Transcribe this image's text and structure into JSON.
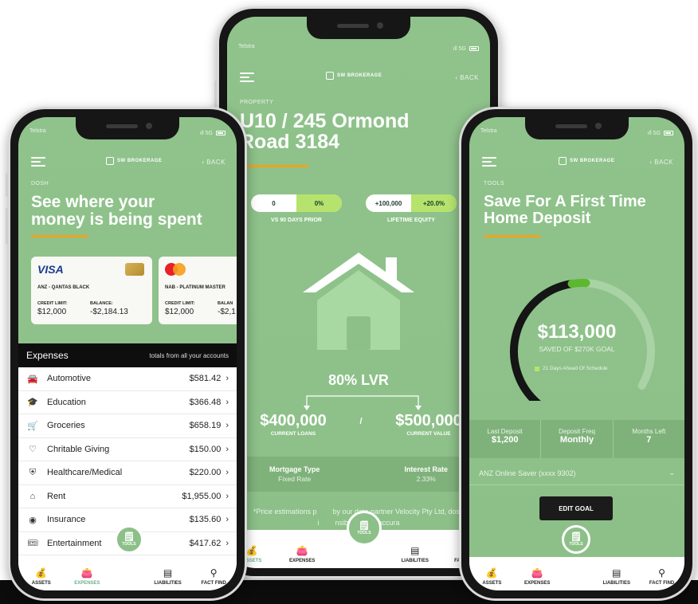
{
  "colors": {
    "brand_green": "#8cc088",
    "accent_orange": "#f2a21b",
    "lime": "#b6e36d",
    "dark": "#0e0e0e"
  },
  "phone_left": {
    "status": {
      "carrier": "Telstra",
      "signal": "ıll 5G"
    },
    "brand": "SW BROKERAGE",
    "back": "‹ BACK",
    "section": "DOSH",
    "title_line1": "See where your",
    "title_line2": "money is being spent",
    "cards": [
      {
        "brand": "VISA",
        "name": "ANZ - QANTAS BLACK",
        "limit_label": "CREDIT LIMIT:",
        "limit": "$12,000",
        "balance_label": "BALANCE:",
        "balance": "-$2,184.13"
      },
      {
        "name": "NAB - PLATINUM MASTER",
        "limit_label": "CREDIT LIMIT:",
        "limit": "$12,000",
        "balance_label": "BALAN",
        "balance": "-$2,1"
      }
    ],
    "expenses_header": {
      "title": "Expenses",
      "subtitle": "totals from all your accounts"
    },
    "expenses": [
      {
        "icon": "car-icon",
        "glyph": "🚘",
        "name": "Automotive",
        "amount": "$581.42"
      },
      {
        "icon": "education-icon",
        "glyph": "🎓",
        "name": "Education",
        "amount": "$366.48"
      },
      {
        "icon": "groceries-icon",
        "glyph": "🛒",
        "name": "Groceries",
        "amount": "$658.19"
      },
      {
        "icon": "giving-icon",
        "glyph": "♡",
        "name": "Chritable Giving",
        "amount": "$150.00"
      },
      {
        "icon": "healthcare-icon",
        "glyph": "⛨",
        "name": "Healthcare/Medical",
        "amount": "$220.00"
      },
      {
        "icon": "rent-icon",
        "glyph": "⌂",
        "name": "Rent",
        "amount": "$1,955.00"
      },
      {
        "icon": "insurance-icon",
        "glyph": "◉",
        "name": "Insurance",
        "amount": "$135.60"
      },
      {
        "icon": "entertainment-icon",
        "glyph": "🎟",
        "name": "Entertainment",
        "amount": "$417.62"
      }
    ],
    "tabs": [
      {
        "icon": "assets-icon",
        "glyph": "💰",
        "label": "ASSETS"
      },
      {
        "icon": "expenses-icon",
        "glyph": "👛",
        "label": "EXPENSES"
      },
      {
        "icon": "liabilities-icon",
        "glyph": "▤",
        "label": "LIABILITIES"
      },
      {
        "icon": "fact-find-icon",
        "glyph": "⚲",
        "label": "FACT FIND"
      }
    ],
    "tools_label": "TOOLS"
  },
  "phone_middle": {
    "status": {
      "carrier": "Telstra",
      "signal": "ıll 5G"
    },
    "brand": "SW BROKERAGE",
    "back": "‹ BACK",
    "section": "PROPERTY",
    "title_line1": "U10 / 245 Ormond",
    "title_line2": "Road 3184",
    "pill_left": {
      "a": "0",
      "b": "0%",
      "caption": "VS 90 DAYS PRIOR"
    },
    "pill_right": {
      "a": "+100,000",
      "b": "+20.0%",
      "caption": "LIFETIME EQUITY"
    },
    "lvr": "80% LVR",
    "loans": {
      "value": "$400,000",
      "caption": "CURRENT LOANS"
    },
    "divider": "/",
    "value": {
      "value": "$500,000",
      "caption": "CURRENT VALUE"
    },
    "mortgage": {
      "label": "Mortgage Type",
      "value": "Fixed Rate"
    },
    "interest": {
      "label": "Interest Rate",
      "value": "2.33%"
    },
    "disclaimer": "*Price estimations p        by our data partner Velocity Pty Ltd, dosh i        nsible for the accura",
    "tabs": [
      {
        "icon": "assets-icon",
        "glyph": "💰",
        "label": "ASSETS"
      },
      {
        "icon": "expenses-icon",
        "glyph": "👛",
        "label": "EXPENSES"
      },
      {
        "icon": "liabilities-icon",
        "glyph": "▤",
        "label": "LIABILITIES"
      },
      {
        "icon": "fact-find-icon",
        "glyph": "⚲",
        "label": "FACT FIN"
      }
    ],
    "tools_label": "TOOLS"
  },
  "phone_right": {
    "status": {
      "carrier": "Telstra",
      "signal": "ıll 5G"
    },
    "brand": "SW BROKERAGE",
    "back": "‹ BACK",
    "section": "TOOLS",
    "title_line1": "Save For A First Time",
    "title_line2": "Home Deposit",
    "gauge": {
      "amount": "$113,000",
      "subtitle": "SAVED OF $270K GOAL",
      "schedule": "21 Days Ahead Of Schedule",
      "progress": 0.55
    },
    "stats": [
      {
        "label": "Last Deposit",
        "value": "$1,200"
      },
      {
        "label": "Deposit Freq",
        "value": "Monthly"
      },
      {
        "label": "Months Left",
        "value": "7"
      }
    ],
    "account": "ANZ Online Saver (xxxx 9302)",
    "edit_button": "EDIT GOAL",
    "tabs": [
      {
        "icon": "assets-icon",
        "glyph": "💰",
        "label": "ASSETS"
      },
      {
        "icon": "expenses-icon",
        "glyph": "👛",
        "label": "EXPENSES"
      },
      {
        "icon": "liabilities-icon",
        "glyph": "▤",
        "label": "LIABILITIES"
      },
      {
        "icon": "fact-find-icon",
        "glyph": "⚲",
        "label": "FACT FIND"
      }
    ],
    "tools_label": "TOOLS"
  }
}
